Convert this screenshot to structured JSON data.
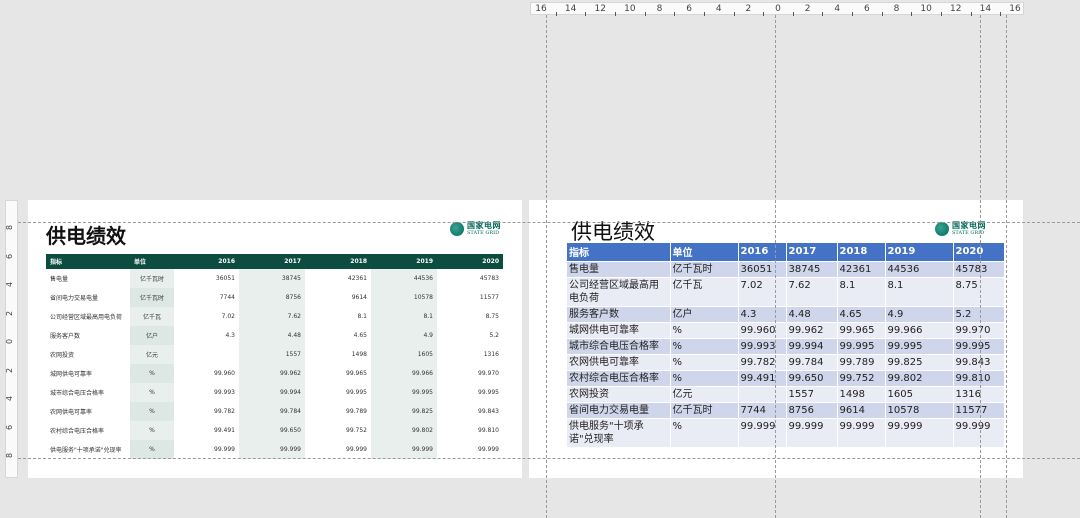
{
  "ruler": {
    "h_labels": [
      "16",
      "14",
      "12",
      "10",
      "8",
      "6",
      "4",
      "2",
      "0",
      "2",
      "4",
      "6",
      "8",
      "10",
      "12",
      "14",
      "16"
    ],
    "v_labels": [
      "8",
      "6",
      "4",
      "2",
      "0",
      "2",
      "4",
      "6",
      "8"
    ]
  },
  "left_slide": {
    "title": "供电绩效",
    "logo": {
      "cn": "国家电网",
      "en": "STATE GRID"
    },
    "headers": [
      "指标",
      "单位",
      "2016",
      "2017",
      "2018",
      "2019",
      "2020"
    ],
    "rows": [
      [
        "售电量",
        "亿千瓦时",
        "36051",
        "38745",
        "42361",
        "44536",
        "45783"
      ],
      [
        "省间电力交易电量",
        "亿千瓦时",
        "7744",
        "8756",
        "9614",
        "10578",
        "11577"
      ],
      [
        "公司经营区域最高用电负荷",
        "亿千瓦",
        "7.02",
        "7.62",
        "8.1",
        "8.1",
        "8.75"
      ],
      [
        "服务客户数",
        "亿户",
        "4.3",
        "4.48",
        "4.65",
        "4.9",
        "5.2"
      ],
      [
        "农网投资",
        "亿元",
        "",
        "1557",
        "1498",
        "1605",
        "1316"
      ],
      [
        "城网供电可靠率",
        "%",
        "99.960",
        "99.962",
        "99.965",
        "99.966",
        "99.970"
      ],
      [
        "城市综合电压合格率",
        "%",
        "99.993",
        "99.994",
        "99.995",
        "99.995",
        "99.995"
      ],
      [
        "农网供电可靠率",
        "%",
        "99.782",
        "99.784",
        "99.789",
        "99.825",
        "99.843"
      ],
      [
        "农村综合电压合格率",
        "%",
        "99.491",
        "99.650",
        "99.752",
        "99.802",
        "99.810"
      ],
      [
        "供电服务\"十项承诺\"兑现率",
        "%",
        "99.999",
        "99.999",
        "99.999",
        "99.999",
        "99.999"
      ]
    ]
  },
  "right_slide": {
    "title": "供电绩效",
    "logo": {
      "cn": "国家电网",
      "en": "STATE GRID"
    },
    "headers": [
      "指标",
      "单位",
      "2016",
      "2017",
      "2018",
      "2019",
      "2020"
    ],
    "rows": [
      [
        "售电量",
        "亿千瓦时",
        "36051",
        "38745",
        "42361",
        "44536",
        "45783"
      ],
      [
        "公司经营区域最高用电负荷",
        "亿千瓦",
        "7.02",
        "7.62",
        "8.1",
        "8.1",
        "8.75"
      ],
      [
        "服务客户数",
        "亿户",
        "4.3",
        "4.48",
        "4.65",
        "4.9",
        "5.2"
      ],
      [
        "城网供电可靠率",
        "%",
        "99.960",
        "99.962",
        "99.965",
        "99.966",
        "99.970"
      ],
      [
        "城市综合电压合格率",
        "%",
        "99.993",
        "99.994",
        "99.995",
        "99.995",
        "99.995"
      ],
      [
        "农网供电可靠率",
        "%",
        "99.782",
        "99.784",
        "99.789",
        "99.825",
        "99.843"
      ],
      [
        "农村综合电压合格率",
        "%",
        "99.491",
        "99.650",
        "99.752",
        "99.802",
        "99.810"
      ],
      [
        "农网投资",
        "亿元",
        "",
        "1557",
        "1498",
        "1605",
        "1316"
      ],
      [
        "省间电力交易电量",
        "亿千瓦时",
        "7744",
        "8756",
        "9614",
        "10578",
        "11577"
      ],
      [
        "供电服务\"十项承诺\"兑现率",
        "%",
        "99.999",
        "99.999",
        "99.999",
        "99.999",
        "99.999"
      ]
    ]
  }
}
